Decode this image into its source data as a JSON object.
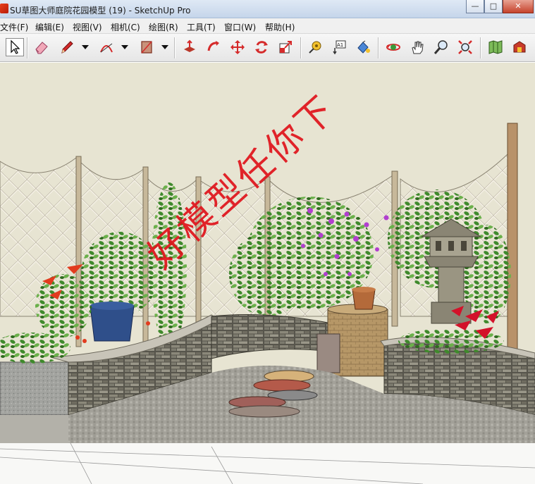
{
  "window": {
    "title": "SU草图大师庭院花园模型 (19) - SketchUp Pro",
    "minimize_glyph": "—",
    "maximize_glyph": "□",
    "close_glyph": "✕"
  },
  "menu": {
    "items": [
      {
        "label": "文件(F)"
      },
      {
        "label": "编辑(E)"
      },
      {
        "label": "视图(V)"
      },
      {
        "label": "相机(C)"
      },
      {
        "label": "绘图(R)"
      },
      {
        "label": "工具(T)"
      },
      {
        "label": "窗口(W)"
      },
      {
        "label": "帮助(H)"
      }
    ]
  },
  "toolbar": {
    "tools": [
      {
        "icon": "select-arrow-icon",
        "selected": true
      },
      {
        "icon": "eraser-icon"
      },
      {
        "icon": "pencil-line-icon"
      },
      {
        "icon": "arc-icon"
      },
      {
        "icon": "rectangle-icon"
      },
      {
        "icon": "push-pull-icon"
      },
      {
        "icon": "follow-me-icon"
      },
      {
        "icon": "move-icon"
      },
      {
        "icon": "rotate-icon"
      },
      {
        "icon": "scale-icon"
      },
      {
        "icon": "tape-measure-icon"
      },
      {
        "icon": "text-icon"
      },
      {
        "icon": "paint-bucket-icon"
      },
      {
        "icon": "orbit-icon"
      },
      {
        "icon": "pan-hand-icon"
      },
      {
        "icon": "zoom-icon"
      },
      {
        "icon": "zoom-extents-icon"
      },
      {
        "icon": "map-icon"
      },
      {
        "icon": "extension-warehouse-icon"
      }
    ],
    "text_tool_label": "A1"
  },
  "viewport": {
    "watermark": "好模型任你下",
    "colors": {
      "sky": "#e7e4d2",
      "lattice": "#efeadd",
      "stone_wall": "#6e6b60",
      "paving": "#9c9a92",
      "foliage": "#3f8a2c",
      "flowers": "#b13fcf",
      "watermark": "#e0131b"
    }
  }
}
